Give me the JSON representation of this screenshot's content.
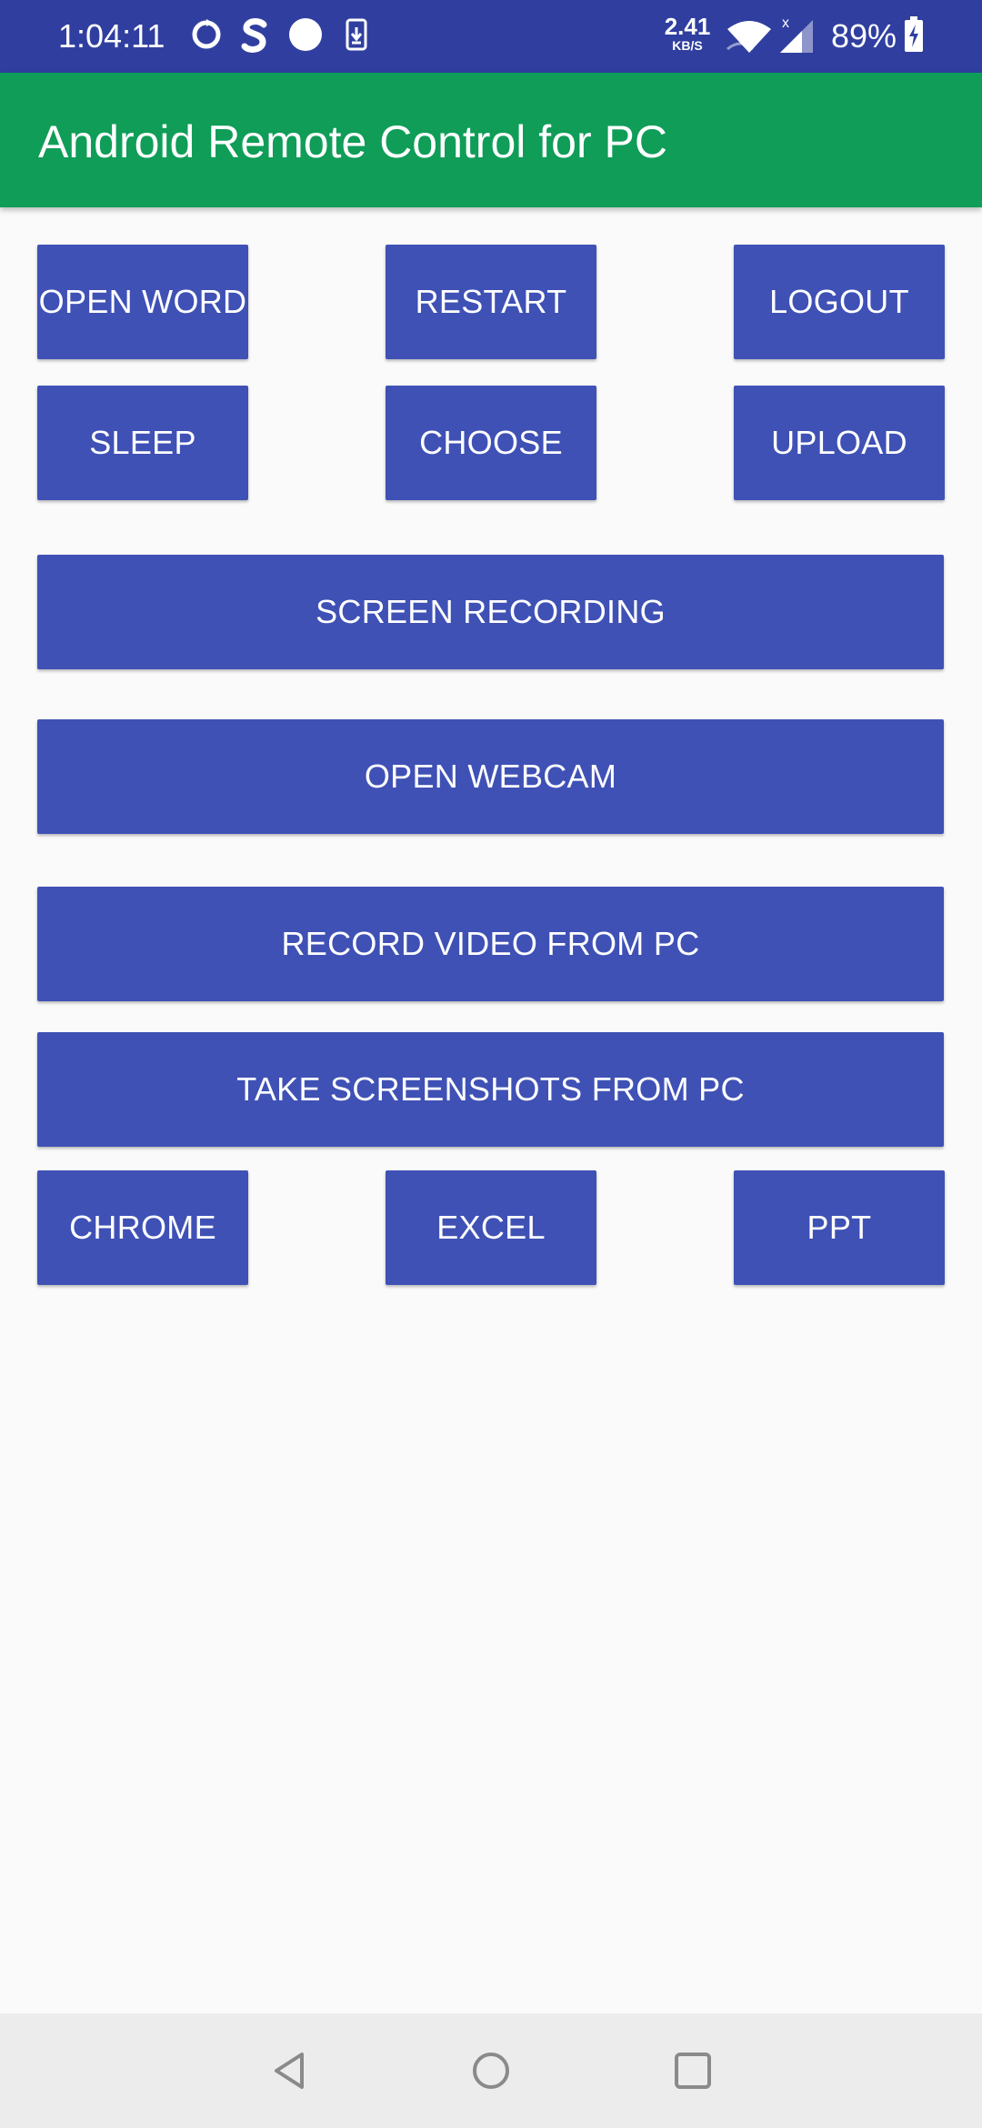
{
  "status_bar": {
    "time": "1:04:11",
    "net_speed_value": "2.41",
    "net_speed_unit": "KB/S",
    "battery": "89%",
    "icons": [
      "sync-circle-icon",
      "s-app-icon",
      "dot-notification-icon",
      "download-phone-icon",
      "wifi-icon",
      "cell-signal-icon",
      "battery-charging-icon"
    ]
  },
  "app_bar": {
    "title": "Android Remote Control for PC",
    "color": "#0f9d58"
  },
  "buttons": {
    "open_word": "OPEN WORD",
    "restart": "RESTART",
    "logout": "LOGOUT",
    "sleep": "SLEEP",
    "choose": "CHOOSE",
    "upload": "UPLOAD",
    "screen_recording": "SCREEN RECORDING",
    "open_webcam": "OPEN WEBCAM",
    "record_video": "RECORD VIDEO FROM PC",
    "take_screenshots": "TAKE SCREENSHOTS FROM PC",
    "chrome": "CHROME",
    "excel": "EXCEL",
    "ppt": "PPT"
  },
  "colors": {
    "status_bar": "#303f9f",
    "button": "#3f51b5",
    "background": "#fafafa"
  },
  "nav_bar": {
    "icons": [
      "back-icon",
      "home-icon",
      "recents-icon"
    ]
  }
}
